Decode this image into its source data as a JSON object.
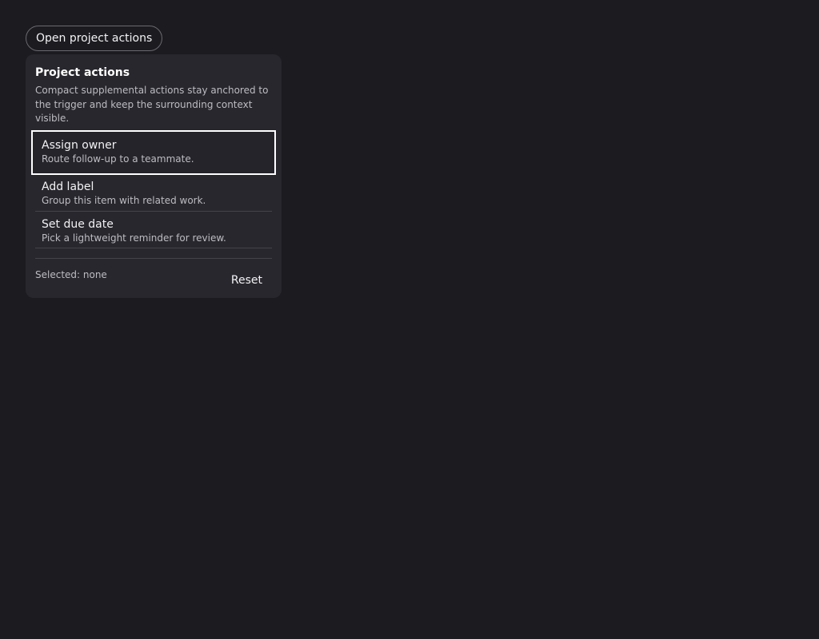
{
  "trigger": {
    "label": "Open project actions"
  },
  "panel": {
    "title": "Project actions",
    "description": "Compact supplemental actions stay anchored to the trigger and keep the surrounding context visible.",
    "items": [
      {
        "label": "Assign owner",
        "description": "Route follow-up to a teammate.",
        "focused": true
      },
      {
        "label": "Add label",
        "description": "Group this item with related work.",
        "focused": false
      },
      {
        "label": "Set due date",
        "description": "Pick a lightweight reminder for review.",
        "focused": false
      }
    ],
    "selected_text": "Selected: none",
    "reset_label": "Reset"
  },
  "colors": {
    "background": "#1c1b20",
    "panel": "#28272d",
    "focus_ring": "#ffffff",
    "text_primary": "#f2f2f4",
    "text_secondary": "#bdbcc3"
  }
}
